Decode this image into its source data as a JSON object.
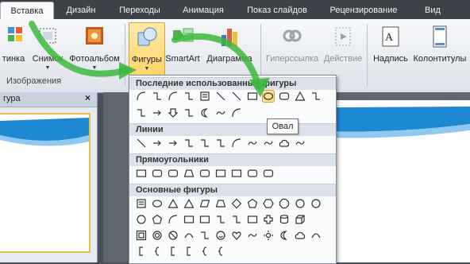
{
  "tabs": [
    "Вставка",
    "Дизайн",
    "Переходы",
    "Анимация",
    "Показ слайдов",
    "Рецензирование",
    "Вид"
  ],
  "ribbon": {
    "buttons": [
      "тинка",
      "Снимок",
      "Фотоальбом",
      "Фигуры",
      "SmartArt",
      "Диаграмма",
      "Гиперссылка",
      "Действие",
      "Надпись",
      "Колонтитулы"
    ],
    "group_label": "Изображения"
  },
  "left_panel": {
    "title": "гура",
    "close": "×"
  },
  "dropdown": {
    "recent_title": "Последние использованные фигуры",
    "lines_title": "Линии",
    "rect_title": "Прямоугольники",
    "basic_title": "Основные фигуры"
  },
  "tooltip": "Овал",
  "colors": {
    "tab_bar": "#3d4249",
    "active_button": "#ffcf5e",
    "selected_shape": "#ffe08a",
    "green_arrow": "#3db83d",
    "slide_blue": "#1f88d2"
  }
}
